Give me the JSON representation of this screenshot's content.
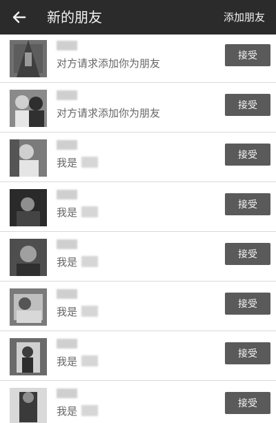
{
  "header": {
    "title": "新的朋友",
    "right_action": "添加朋友",
    "bg_color": "#2b2b2b"
  },
  "requests": [
    {
      "sub": "对方请求添加你为朋友",
      "button": "接受",
      "avatar": "dark-interior-photo"
    },
    {
      "sub": "对方请求添加你为朋友",
      "button": "接受",
      "avatar": "two-people-photo"
    },
    {
      "sub": "我是",
      "button": "接受",
      "avatar": "selfie-photo"
    },
    {
      "sub": "我是",
      "button": "接受",
      "avatar": "dark-selfie-photo"
    },
    {
      "sub": "我是",
      "button": "接受",
      "avatar": "portrait-photo"
    },
    {
      "sub": "我是",
      "button": "接受",
      "avatar": "bed-photo"
    },
    {
      "sub": "我是",
      "button": "接受",
      "avatar": "mirror-selfie-photo"
    },
    {
      "sub": "我是",
      "button": "接受",
      "avatar": "standing-person-photo"
    }
  ]
}
